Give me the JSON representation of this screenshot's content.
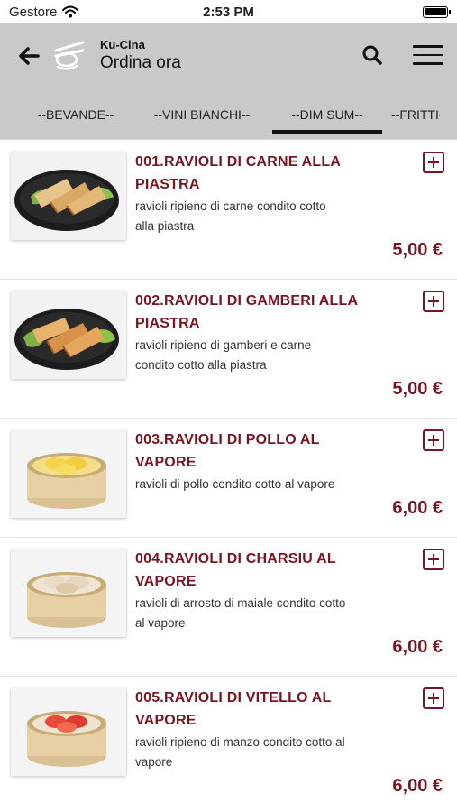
{
  "status_bar": {
    "carrier": "Gestore",
    "time": "2:53 PM"
  },
  "header": {
    "brand": "Ku-Cina",
    "title": "Ordina ora"
  },
  "tabs": [
    {
      "label": "--BEVANDE--"
    },
    {
      "label": "--VINI BIANCHI--"
    },
    {
      "label": "--DIM SUM--",
      "active": true
    },
    {
      "label": "--FRITTI--"
    }
  ],
  "items": [
    {
      "name_line1": "001.RAVIOLI DI CARNE ALLA",
      "name_line2": "PIASTRA",
      "desc_line1": "ravioli ripieno di carne condito cotto",
      "desc_line2": "alla piastra",
      "price": "5,00 €",
      "image": "fried-dumplings-plate"
    },
    {
      "name_line1": "002.RAVIOLI DI GAMBERI ALLA",
      "name_line2": "PIASTRA",
      "desc_line1": "ravioli ripieno di gamberi e carne",
      "desc_line2": "condito cotto alla piastra",
      "price": "5,00 €",
      "image": "fried-dumplings-plate"
    },
    {
      "name_line1": "003.RAVIOLI DI POLLO AL",
      "name_line2": "VAPORE",
      "desc_line1": "ravioli di pollo condito cotto al vapore",
      "desc_line2": "",
      "price": "6,00 €",
      "image": "steamer-basket-yellow"
    },
    {
      "name_line1": "004.RAVIOLI DI CHARSIU AL",
      "name_line2": "VAPORE",
      "desc_line1": "ravioli di arrosto di maiale condito cotto",
      "desc_line2": "al vapore",
      "price": "6,00 €",
      "image": "steamer-basket-white"
    },
    {
      "name_line1": "005.RAVIOLI DI VITELLO AL",
      "name_line2": "VAPORE",
      "desc_line1": "ravioli ripieno di manzo condito cotto al",
      "desc_line2": "vapore",
      "price": "6,00 €",
      "image": "steamer-basket-red"
    }
  ],
  "colors": {
    "header_bg": "#c9c9c9",
    "accent": "#7a1420"
  }
}
